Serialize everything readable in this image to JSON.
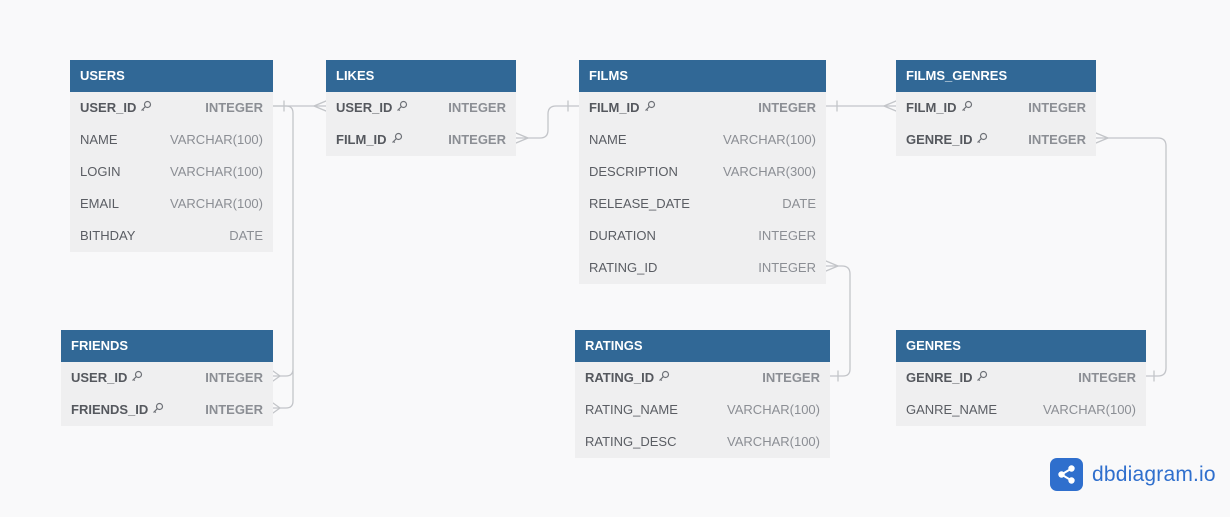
{
  "diagram": {
    "tables": {
      "users": {
        "name": "USERS",
        "fields": [
          {
            "name": "USER_ID",
            "type": "INTEGER",
            "pk": true
          },
          {
            "name": "NAME",
            "type": "VARCHAR(100)"
          },
          {
            "name": "LOGIN",
            "type": "VARCHAR(100)"
          },
          {
            "name": "EMAIL",
            "type": "VARCHAR(100)"
          },
          {
            "name": "BITHDAY",
            "type": "DATE"
          }
        ]
      },
      "likes": {
        "name": "LIKES",
        "fields": [
          {
            "name": "USER_ID",
            "type": "INTEGER",
            "pk": true
          },
          {
            "name": "FILM_ID",
            "type": "INTEGER",
            "pk": true
          }
        ]
      },
      "films": {
        "name": "FILMS",
        "fields": [
          {
            "name": "FILM_ID",
            "type": "INTEGER",
            "pk": true
          },
          {
            "name": "NAME",
            "type": "VARCHAR(100)"
          },
          {
            "name": "DESCRIPTION",
            "type": "VARCHAR(300)"
          },
          {
            "name": "RELEASE_DATE",
            "type": "DATE"
          },
          {
            "name": "DURATION",
            "type": "INTEGER"
          },
          {
            "name": "RATING_ID",
            "type": "INTEGER"
          }
        ]
      },
      "films_genres": {
        "name": "FILMS_GENRES",
        "fields": [
          {
            "name": "FILM_ID",
            "type": "INTEGER",
            "pk": true
          },
          {
            "name": "GENRE_ID",
            "type": "INTEGER",
            "pk": true
          }
        ]
      },
      "friends": {
        "name": "FRIENDS",
        "fields": [
          {
            "name": "USER_ID",
            "type": "INTEGER",
            "pk": true
          },
          {
            "name": "FRIENDS_ID",
            "type": "INTEGER",
            "pk": true
          }
        ]
      },
      "ratings": {
        "name": "RATINGS",
        "fields": [
          {
            "name": "RATING_ID",
            "type": "INTEGER",
            "pk": true
          },
          {
            "name": "RATING_NAME",
            "type": "VARCHAR(100)"
          },
          {
            "name": "RATING_DESC",
            "type": "VARCHAR(100)"
          }
        ]
      },
      "genres": {
        "name": "GENRES",
        "fields": [
          {
            "name": "GENRE_ID",
            "type": "INTEGER",
            "pk": true
          },
          {
            "name": "GANRE_NAME",
            "type": "VARCHAR(100)"
          }
        ]
      }
    },
    "relationships": [
      {
        "from": "users.USER_ID",
        "to": "likes.USER_ID",
        "type": "one-to-many"
      },
      {
        "from": "users.USER_ID",
        "to": "friends.USER_ID",
        "type": "one-to-many"
      },
      {
        "from": "users.USER_ID",
        "to": "friends.FRIENDS_ID",
        "type": "one-to-many"
      },
      {
        "from": "films.FILM_ID",
        "to": "likes.FILM_ID",
        "type": "one-to-many"
      },
      {
        "from": "films.FILM_ID",
        "to": "films_genres.FILM_ID",
        "type": "one-to-many"
      },
      {
        "from": "ratings.RATING_ID",
        "to": "films.RATING_ID",
        "type": "one-to-many"
      },
      {
        "from": "genres.GENRE_ID",
        "to": "films_genres.GENRE_ID",
        "type": "one-to-many"
      }
    ],
    "colors": {
      "header": "#316896",
      "body": "#efeff0",
      "background": "#f9f9fa",
      "connector": "#c3c5c9",
      "brand": "#2f6fcd"
    }
  },
  "branding": {
    "logo_text": "dbdiagram.io",
    "logo_icon": "share-nodes-icon"
  }
}
